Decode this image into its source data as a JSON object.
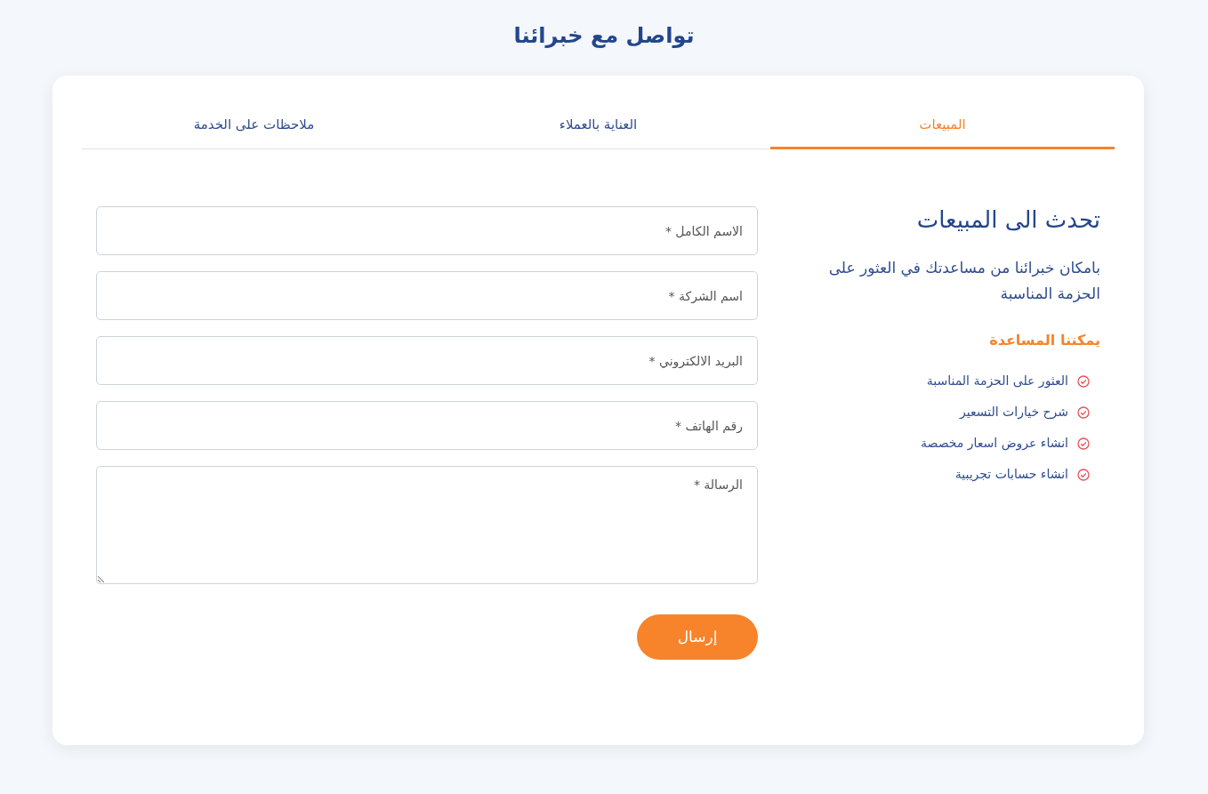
{
  "page_title": "تواصل مع خبرائنا",
  "tabs": [
    {
      "label": "المبيعات",
      "selected": true
    },
    {
      "label": "العناية بالعملاء",
      "selected": false
    },
    {
      "label": "ملاحظات على الخدمة",
      "selected": false
    }
  ],
  "info": {
    "heading": "تحدث الى المبيعات",
    "description": "بامكان خبرائنا من مساعدتك في العثور على الحزمة المناسبة",
    "subheading": "يمكننا المساعدة",
    "items": [
      "العثور على الحزمة المناسبة",
      "شرح خيارات التسعير",
      "انشاء عروض اسعار مخصصة",
      "انشاء حسابات تجريبية"
    ]
  },
  "form": {
    "fields": [
      {
        "kind": "input",
        "placeholder": "الاسم الكامل *"
      },
      {
        "kind": "input",
        "placeholder": "اسم الشركة *"
      },
      {
        "kind": "input",
        "placeholder": "البريد الالكتروني *"
      },
      {
        "kind": "input",
        "placeholder": "رقم الهاتف *"
      },
      {
        "kind": "textarea",
        "placeholder": "الرسالة *"
      }
    ],
    "submit": "إرسال"
  }
}
